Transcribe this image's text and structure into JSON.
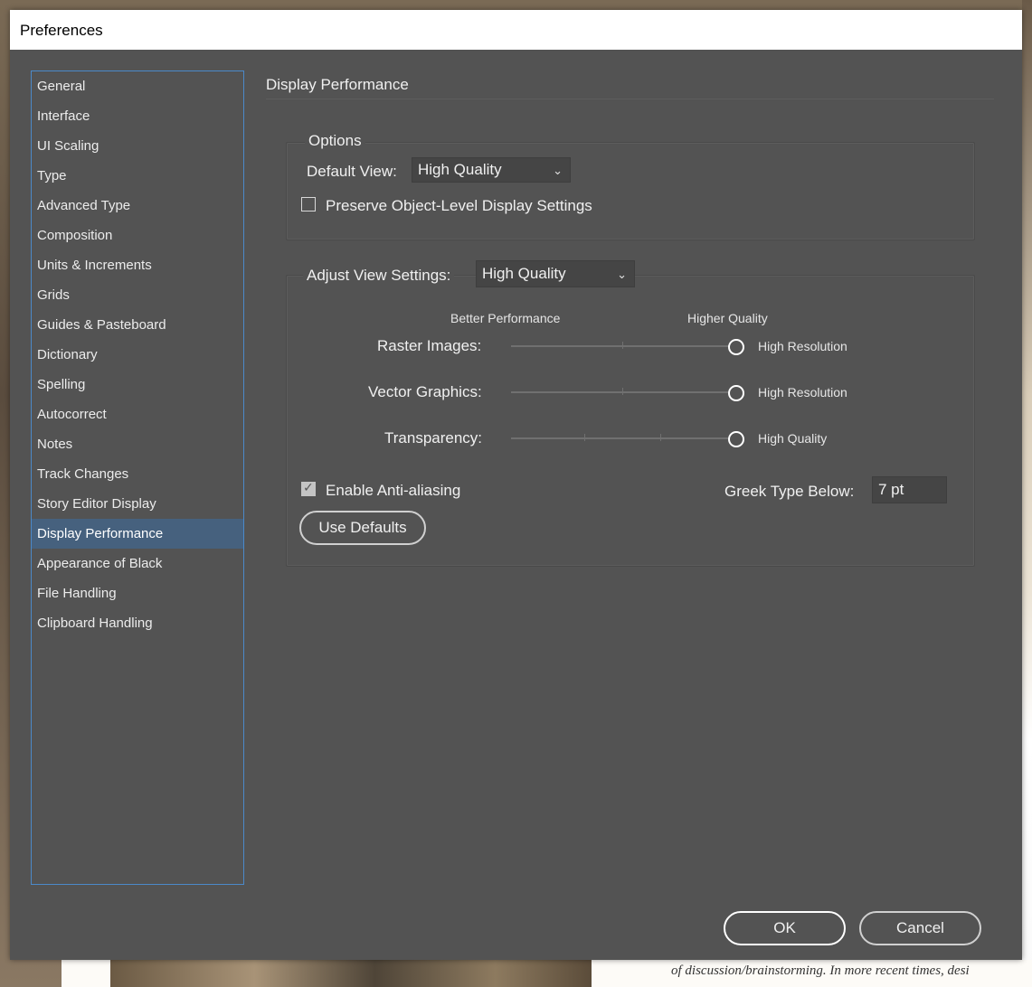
{
  "window": {
    "title": "Preferences"
  },
  "sidebar": {
    "selected_index": 15,
    "items": [
      {
        "label": "General"
      },
      {
        "label": "Interface"
      },
      {
        "label": "UI Scaling"
      },
      {
        "label": "Type"
      },
      {
        "label": "Advanced Type"
      },
      {
        "label": "Composition"
      },
      {
        "label": "Units & Increments"
      },
      {
        "label": "Grids"
      },
      {
        "label": "Guides & Pasteboard"
      },
      {
        "label": "Dictionary"
      },
      {
        "label": "Spelling"
      },
      {
        "label": "Autocorrect"
      },
      {
        "label": "Notes"
      },
      {
        "label": "Track Changes"
      },
      {
        "label": "Story Editor Display"
      },
      {
        "label": "Display Performance"
      },
      {
        "label": "Appearance of Black"
      },
      {
        "label": "File Handling"
      },
      {
        "label": "Clipboard Handling"
      }
    ]
  },
  "panel": {
    "title": "Display Performance",
    "options": {
      "legend": "Options",
      "default_view_label": "Default View:",
      "default_view_value": "High Quality",
      "preserve_label": "Preserve Object-Level Display Settings",
      "preserve_checked": false
    },
    "adjust": {
      "label": "Adjust View Settings:",
      "value": "High Quality",
      "better_performance": "Better Performance",
      "higher_quality": "Higher Quality",
      "sliders": [
        {
          "label": "Raster Images:",
          "value_text": "High Resolution",
          "level": 1.0
        },
        {
          "label": "Vector Graphics:",
          "value_text": "High Resolution",
          "level": 1.0
        },
        {
          "label": "Transparency:",
          "value_text": "High Quality",
          "level": 1.0
        }
      ],
      "anti_aliasing_label": "Enable Anti-aliasing",
      "anti_aliasing_checked": true,
      "greek_label": "Greek Type Below:",
      "greek_value": "7 pt",
      "use_defaults": "Use Defaults"
    }
  },
  "footer": {
    "ok": "OK",
    "cancel": "Cancel"
  },
  "background": {
    "caption": "of discussion/brainstorming.  In more recent times, desi"
  }
}
